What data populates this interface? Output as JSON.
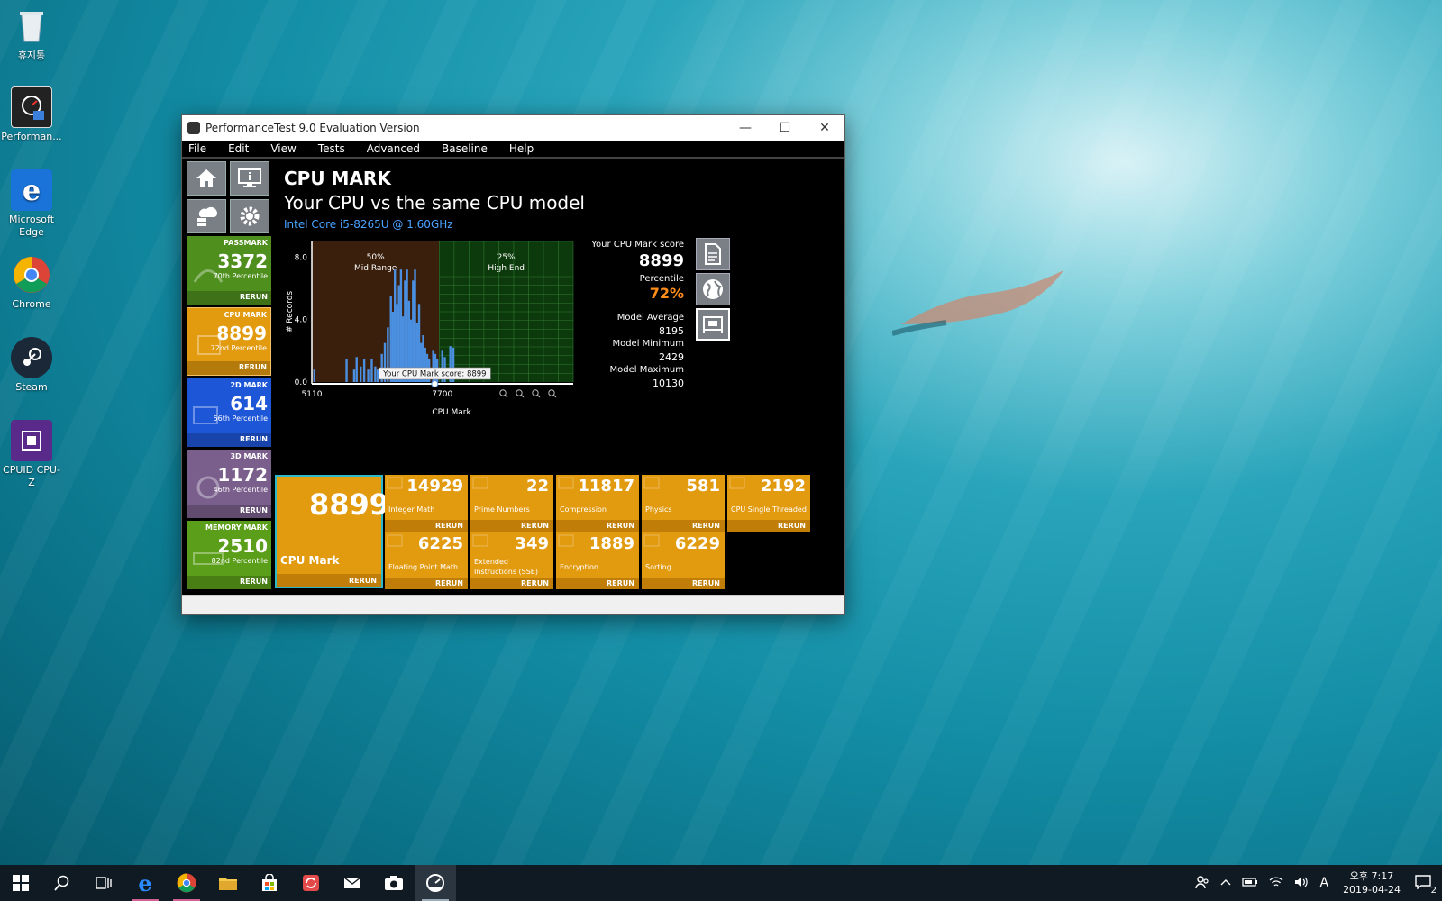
{
  "desktop": {
    "icons": [
      {
        "label": "휴지통"
      },
      {
        "label": "Performan..."
      },
      {
        "label": "Microsoft Edge"
      },
      {
        "label": "Chrome"
      },
      {
        "label": "Steam"
      },
      {
        "label": "CPUID CPU-Z"
      }
    ]
  },
  "window": {
    "title": "PerformanceTest 9.0 Evaluation Version",
    "controls": {
      "minimize": "—",
      "maximize": "☐",
      "close": "✕"
    }
  },
  "menu": [
    "File",
    "Edit",
    "View",
    "Tests",
    "Advanced",
    "Baseline",
    "Help"
  ],
  "sidebar": {
    "tiles": [
      {
        "label": "PASSMARK",
        "score": "3372",
        "percentile": "70th Percentile",
        "rerun": "RERUN",
        "color": "#4f8f1e"
      },
      {
        "label": "CPU MARK",
        "score": "8899",
        "percentile": "72nd Percentile",
        "rerun": "RERUN",
        "color": "#e29a0f"
      },
      {
        "label": "2D MARK",
        "score": "614",
        "percentile": "56th Percentile",
        "rerun": "RERUN",
        "color": "#1e56d8"
      },
      {
        "label": "3D MARK",
        "score": "1172",
        "percentile": "46th Percentile",
        "rerun": "RERUN",
        "color": "#7a5f8c"
      },
      {
        "label": "MEMORY MARK",
        "score": "2510",
        "percentile": "82nd Percentile",
        "rerun": "RERUN",
        "color": "#5a9e1a"
      }
    ]
  },
  "header": {
    "title": "CPU MARK",
    "subtitle": "Your CPU vs the same CPU model",
    "cpu": "Intel Core i5-8265U @ 1.60GHz"
  },
  "chart_data": {
    "type": "bar",
    "xlabel": "CPU Mark",
    "ylabel": "# Records",
    "xlim": [
      5110,
      10300
    ],
    "ylim": [
      0,
      9.0
    ],
    "x_ticks": [
      "5110",
      "7700"
    ],
    "y_ticks": [
      "0.0",
      "4.0",
      "8.0"
    ],
    "regions": [
      {
        "label": "50%",
        "sublabel": "Mid Range",
        "from": 5110,
        "to": 7640,
        "color": "#3a1f0c"
      },
      {
        "label": "25%",
        "sublabel": "High End",
        "from": 7640,
        "to": 10300,
        "color": "#0d3a0d"
      }
    ],
    "tooltip": "Your CPU Mark score: 8899",
    "marker": 7550,
    "bars": [
      {
        "x": 5160,
        "y": 0.8
      },
      {
        "x": 5800,
        "y": 1.5
      },
      {
        "x": 5950,
        "y": 0.8
      },
      {
        "x": 6000,
        "y": 1.6
      },
      {
        "x": 6080,
        "y": 1.0
      },
      {
        "x": 6150,
        "y": 1.5
      },
      {
        "x": 6230,
        "y": 0.8
      },
      {
        "x": 6300,
        "y": 1.5
      },
      {
        "x": 6370,
        "y": 1.0
      },
      {
        "x": 6420,
        "y": 0.8
      },
      {
        "x": 6500,
        "y": 1.8
      },
      {
        "x": 6560,
        "y": 2.5
      },
      {
        "x": 6620,
        "y": 3.5
      },
      {
        "x": 6680,
        "y": 5.5
      },
      {
        "x": 6720,
        "y": 4.5
      },
      {
        "x": 6760,
        "y": 7.2
      },
      {
        "x": 6800,
        "y": 5.0
      },
      {
        "x": 6840,
        "y": 6.2
      },
      {
        "x": 6880,
        "y": 7.2
      },
      {
        "x": 6920,
        "y": 4.2
      },
      {
        "x": 6960,
        "y": 6.5
      },
      {
        "x": 7000,
        "y": 7.2
      },
      {
        "x": 7040,
        "y": 5.2
      },
      {
        "x": 7080,
        "y": 4.0
      },
      {
        "x": 7120,
        "y": 6.5
      },
      {
        "x": 7160,
        "y": 7.2
      },
      {
        "x": 7200,
        "y": 3.8
      },
      {
        "x": 7240,
        "y": 5.0
      },
      {
        "x": 7280,
        "y": 2.5
      },
      {
        "x": 7320,
        "y": 3.0
      },
      {
        "x": 7360,
        "y": 2.2
      },
      {
        "x": 7400,
        "y": 1.8
      },
      {
        "x": 7440,
        "y": 1.5
      },
      {
        "x": 7520,
        "y": 2.0
      },
      {
        "x": 7560,
        "y": 1.8
      },
      {
        "x": 7600,
        "y": 1.5
      },
      {
        "x": 7700,
        "y": 2.0
      },
      {
        "x": 7750,
        "y": 1.6
      },
      {
        "x": 7860,
        "y": 2.3
      },
      {
        "x": 7920,
        "y": 2.2
      }
    ]
  },
  "score_panel": {
    "label_score": "Your CPU Mark score",
    "score": "8899",
    "label_percentile": "Percentile",
    "percentile": "72%",
    "label_avg": "Model Average",
    "avg": "8195",
    "label_min": "Model Minimum",
    "min": "2429",
    "label_max": "Model Maximum",
    "max": "10130",
    "percentile_color": "#ff8c1a"
  },
  "results": {
    "main": {
      "score": "8899",
      "name": "CPU Mark",
      "rerun": "RERUN"
    },
    "tiles": [
      {
        "score": "14929",
        "name": "Integer Math",
        "rerun": "RERUN"
      },
      {
        "score": "22",
        "name": "Prime Numbers",
        "rerun": "RERUN"
      },
      {
        "score": "11817",
        "name": "Compression",
        "rerun": "RERUN"
      },
      {
        "score": "581",
        "name": "Physics",
        "rerun": "RERUN"
      },
      {
        "score": "2192",
        "name": "CPU Single Threaded",
        "rerun": "RERUN"
      },
      {
        "score": "6225",
        "name": "Floating Point Math",
        "rerun": "RERUN"
      },
      {
        "score": "349",
        "name": "Extended Instructions (SSE)",
        "rerun": "RERUN"
      },
      {
        "score": "1889",
        "name": "Encryption",
        "rerun": "RERUN"
      },
      {
        "score": "6229",
        "name": "Sorting",
        "rerun": "RERUN"
      }
    ]
  },
  "taskbar": {
    "tray": {
      "input": "A",
      "notifications": "2"
    },
    "clock": {
      "time": "오후 7:17",
      "date": "2019-04-24"
    }
  }
}
